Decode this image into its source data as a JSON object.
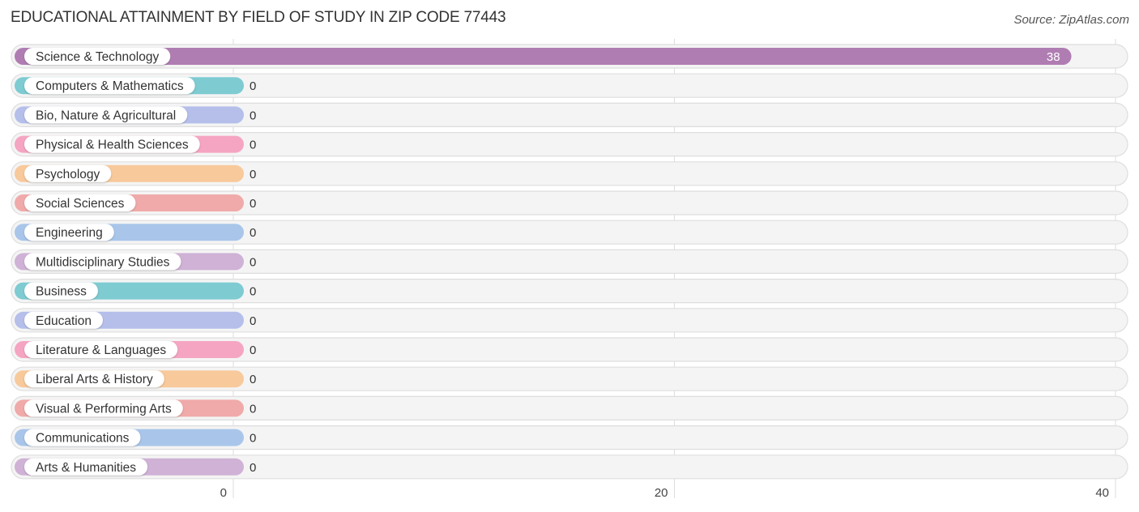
{
  "header": {
    "title": "EDUCATIONAL ATTAINMENT BY FIELD OF STUDY IN ZIP CODE 77443",
    "source": "Source: ZipAtlas.com"
  },
  "chart_data": {
    "type": "bar",
    "orientation": "horizontal",
    "title": "EDUCATIONAL ATTAINMENT BY FIELD OF STUDY IN ZIP CODE 77443",
    "xlabel": "",
    "ylabel": "",
    "xlim": [
      0,
      40
    ],
    "xticks": [
      0,
      20,
      40
    ],
    "grid": true,
    "categories": [
      "Science & Technology",
      "Computers & Mathematics",
      "Bio, Nature & Agricultural",
      "Physical & Health Sciences",
      "Psychology",
      "Social Sciences",
      "Engineering",
      "Multidisciplinary Studies",
      "Business",
      "Education",
      "Literature & Languages",
      "Liberal Arts & History",
      "Visual & Performing Arts",
      "Communications",
      "Arts & Humanities"
    ],
    "values": [
      38,
      0,
      0,
      0,
      0,
      0,
      0,
      0,
      0,
      0,
      0,
      0,
      0,
      0,
      0
    ],
    "colors": [
      "#b07db3",
      "#7ecbd2",
      "#b5bfea",
      "#f5a5c2",
      "#f8c99b",
      "#f0aaa9",
      "#a9c6ea",
      "#cfb2d6",
      "#7ecbd2",
      "#b5bfea",
      "#f5a5c2",
      "#f8c99b",
      "#f0aaa9",
      "#a9c6ea",
      "#cfb2d6"
    ]
  }
}
